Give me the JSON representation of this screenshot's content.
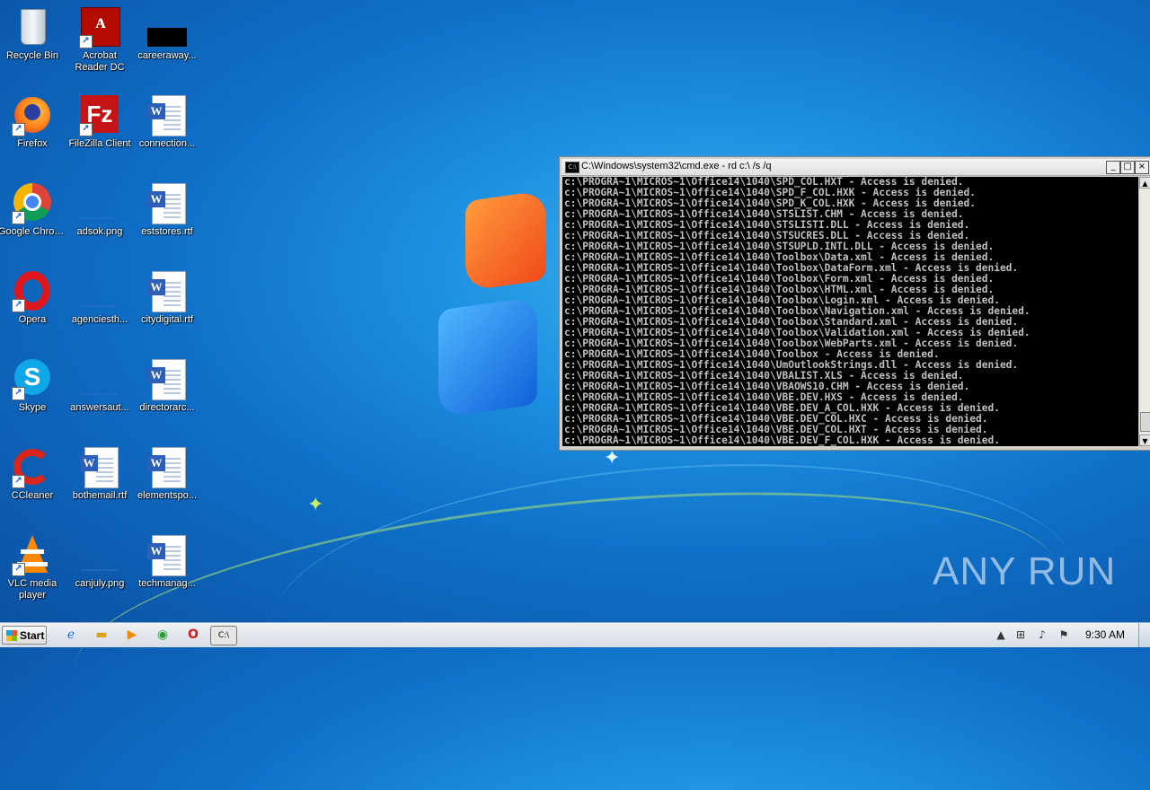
{
  "desktop": {
    "icons": [
      {
        "label": "Recycle Bin",
        "icon": "recycle-bin-icon"
      },
      {
        "label": "Acrobat Reader DC",
        "icon": "acrobat-reader-icon"
      },
      {
        "label": "careeraway...",
        "icon": "black-file-icon"
      },
      {
        "label": "Firefox",
        "icon": "firefox-icon"
      },
      {
        "label": "FileZilla Client",
        "icon": "filezilla-icon"
      },
      {
        "label": "connection...",
        "icon": "word-document-icon"
      },
      {
        "label": "Google Chrome",
        "icon": "chrome-icon"
      },
      {
        "label": "adsok.png",
        "icon": "png-file-icon"
      },
      {
        "label": "eststores.rtf",
        "icon": "word-document-icon"
      },
      {
        "label": "Opera",
        "icon": "opera-icon"
      },
      {
        "label": "agenciesth...",
        "icon": "png-file-icon"
      },
      {
        "label": "citydigital.rtf",
        "icon": "word-document-icon"
      },
      {
        "label": "Skype",
        "icon": "skype-icon"
      },
      {
        "label": "answersaut...",
        "icon": "png-file-icon"
      },
      {
        "label": "directorarc...",
        "icon": "word-document-icon"
      },
      {
        "label": "CCleaner",
        "icon": "ccleaner-icon"
      },
      {
        "label": "bothemail.rtf",
        "icon": "word-document-icon"
      },
      {
        "label": "elementspo...",
        "icon": "word-document-icon"
      },
      {
        "label": "VLC media player",
        "icon": "vlc-icon"
      },
      {
        "label": "canjuly.png",
        "icon": "png-file-icon"
      },
      {
        "label": "techmanag...",
        "icon": "word-document-icon"
      }
    ]
  },
  "cmd_window": {
    "title": "C:\\Windows\\system32\\cmd.exe - rd  c:\\ /s /q",
    "lines": [
      "c:\\PROGRA~1\\MICROS~1\\Office14\\1040\\SPD_COL.HXT - Access is denied.",
      "c:\\PROGRA~1\\MICROS~1\\Office14\\1040\\SPD_F_COL.HXK - Access is denied.",
      "c:\\PROGRA~1\\MICROS~1\\Office14\\1040\\SPD_K_COL.HXK - Access is denied.",
      "c:\\PROGRA~1\\MICROS~1\\Office14\\1040\\STSLIST.CHM - Access is denied.",
      "c:\\PROGRA~1\\MICROS~1\\Office14\\1040\\STSLISTI.DLL - Access is denied.",
      "c:\\PROGRA~1\\MICROS~1\\Office14\\1040\\STSUCRES.DLL - Access is denied.",
      "c:\\PROGRA~1\\MICROS~1\\Office14\\1040\\STSUPLD.INTL.DLL - Access is denied.",
      "c:\\PROGRA~1\\MICROS~1\\Office14\\1040\\Toolbox\\Data.xml - Access is denied.",
      "c:\\PROGRA~1\\MICROS~1\\Office14\\1040\\Toolbox\\DataForm.xml - Access is denied.",
      "c:\\PROGRA~1\\MICROS~1\\Office14\\1040\\Toolbox\\Form.xml - Access is denied.",
      "c:\\PROGRA~1\\MICROS~1\\Office14\\1040\\Toolbox\\HTML.xml - Access is denied.",
      "c:\\PROGRA~1\\MICROS~1\\Office14\\1040\\Toolbox\\Login.xml - Access is denied.",
      "c:\\PROGRA~1\\MICROS~1\\Office14\\1040\\Toolbox\\Navigation.xml - Access is denied.",
      "c:\\PROGRA~1\\MICROS~1\\Office14\\1040\\Toolbox\\Standard.xml - Access is denied.",
      "c:\\PROGRA~1\\MICROS~1\\Office14\\1040\\Toolbox\\Validation.xml - Access is denied.",
      "c:\\PROGRA~1\\MICROS~1\\Office14\\1040\\Toolbox\\WebParts.xml - Access is denied.",
      "c:\\PROGRA~1\\MICROS~1\\Office14\\1040\\Toolbox - Access is denied.",
      "c:\\PROGRA~1\\MICROS~1\\Office14\\1040\\UmOutlookStrings.dll - Access is denied.",
      "c:\\PROGRA~1\\MICROS~1\\Office14\\1040\\VBALIST.XLS - Access is denied.",
      "c:\\PROGRA~1\\MICROS~1\\Office14\\1040\\VBAOWS10.CHM - Access is denied.",
      "c:\\PROGRA~1\\MICROS~1\\Office14\\1040\\VBE.DEV.HXS - Access is denied.",
      "c:\\PROGRA~1\\MICROS~1\\Office14\\1040\\VBE.DEV_A_COL.HXK - Access is denied.",
      "c:\\PROGRA~1\\MICROS~1\\Office14\\1040\\VBE.DEV_COL.HXC - Access is denied.",
      "c:\\PROGRA~1\\MICROS~1\\Office14\\1040\\VBE.DEV_COL.HXT - Access is denied.",
      "c:\\PROGRA~1\\MICROS~1\\Office14\\1040\\VBE.DEV_F_COL.HXK - Access is denied."
    ]
  },
  "watermark": "ANY RUN",
  "taskbar": {
    "start_label": "Start",
    "pinned": [
      "ie-icon",
      "explorer-icon",
      "media-player-icon",
      "chrome-icon",
      "opera-icon",
      "cmd-icon"
    ],
    "clock": "9:30 AM"
  },
  "colors": {
    "desktop_blue": "#0f6fc7",
    "console_bg": "#000000",
    "console_text": "#c0c0c0"
  }
}
